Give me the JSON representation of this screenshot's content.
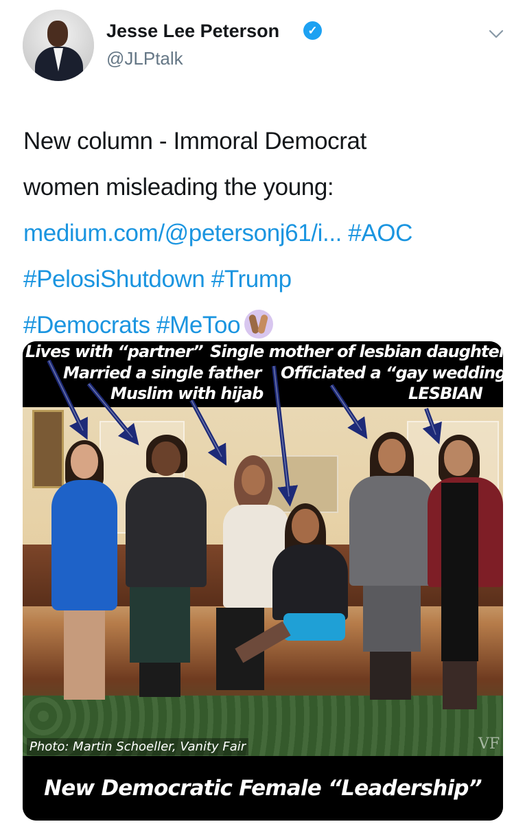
{
  "user": {
    "display_name": "Jesse Lee Peterson",
    "handle": "@JLPtalk",
    "verified_badge": "verified-badge-icon",
    "menu_icon": "chevron-down-icon"
  },
  "tweet": {
    "line1": "New column - Immoral Democrat",
    "line2": "women misleading the young:",
    "link": "medium.com/@petersonj61/i...",
    "hashtags": [
      "#AOC",
      "#PelosiShutdown",
      "#Trump",
      "#Democrats",
      "#MeToo"
    ],
    "emoji": "raised-hands-emoji"
  },
  "media": {
    "captions": [
      "Lives with “partner”",
      "Single mother of lesbian daughter",
      "Married a single father",
      "Officiated a “gay wedding”",
      "Muslim with hijab",
      "LESBIAN"
    ],
    "credit": "Photo: Martin Schoeller, Vanity Fair",
    "watermark": "VF",
    "banner": "New Democratic Female “Leadership”",
    "colors": {
      "arrow": "#1d2a78",
      "banner_bg": "#000000",
      "banner_text": "#ffffff"
    }
  },
  "colors": {
    "link": "#1b95e0",
    "text": "#14171a",
    "secondary": "#657786",
    "verified": "#1da1f2"
  }
}
